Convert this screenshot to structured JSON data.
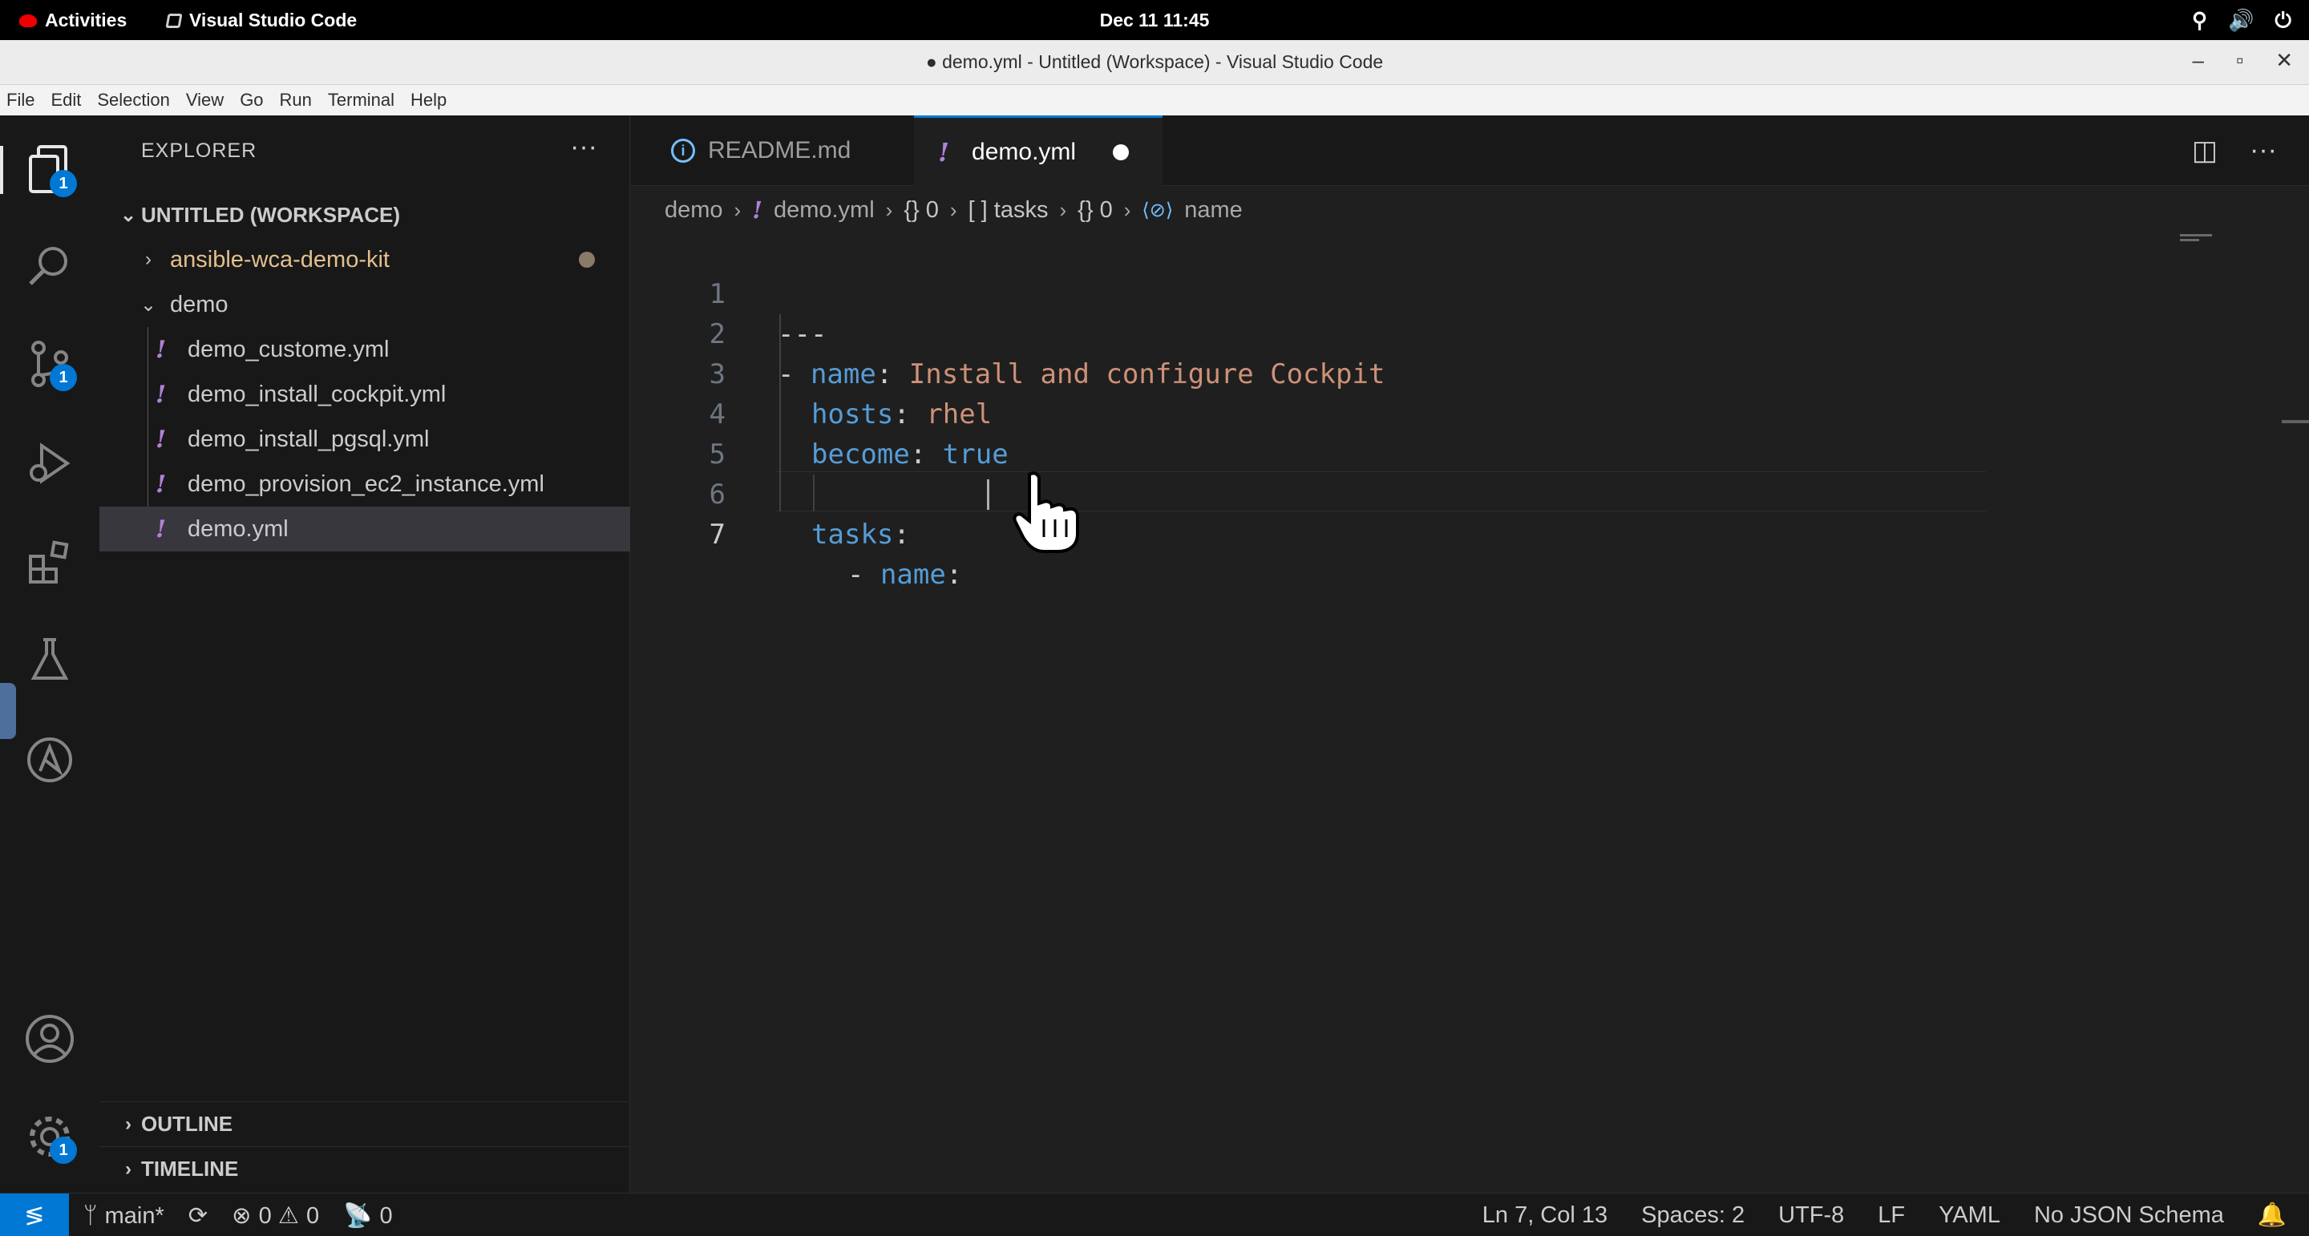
{
  "system": {
    "activities": "Activities",
    "app_name": "Visual Studio Code",
    "clock": "Dec 11  11:45"
  },
  "window": {
    "title": "● demo.yml - Untitled (Workspace) - Visual Studio Code"
  },
  "menu": [
    "File",
    "Edit",
    "Selection",
    "View",
    "Go",
    "Run",
    "Terminal",
    "Help"
  ],
  "activity_bar": {
    "explorer_badge": "1",
    "scm_badge": "1",
    "settings_badge": "1"
  },
  "sidebar": {
    "header": "EXPLORER",
    "workspace": "UNTITLED (WORKSPACE)",
    "items": [
      {
        "label": "ansible-wca-demo-kit"
      },
      {
        "label": "demo"
      },
      {
        "label": "demo_custome.yml"
      },
      {
        "label": "demo_install_cockpit.yml"
      },
      {
        "label": "demo_install_pgsql.yml"
      },
      {
        "label": "demo_provision_ec2_instance.yml"
      },
      {
        "label": "demo.yml"
      }
    ],
    "outline": "OUTLINE",
    "timeline": "TIMELINE"
  },
  "tabs": [
    {
      "label": "README.md"
    },
    {
      "label": "demo.yml"
    }
  ],
  "breadcrumb": {
    "folder": "demo",
    "file": "demo.yml",
    "seg1": "{} 0",
    "seg2": "[ ] tasks",
    "seg3": "{} 0",
    "seg4": "name"
  },
  "code_lines": [
    {
      "n": "1",
      "t1": "---"
    },
    {
      "n": "2",
      "t1": "- ",
      "t2": "name",
      "t3": ": ",
      "t4": "Install and configure Cockpit"
    },
    {
      "n": "3",
      "t2": "hosts",
      "t3": ": ",
      "t4": "rhel"
    },
    {
      "n": "4",
      "t2": "become",
      "t3": ": ",
      "t4": "true"
    },
    {
      "n": "5"
    },
    {
      "n": "6",
      "t2": "tasks",
      "t3": ":"
    },
    {
      "n": "7",
      "t1": "- ",
      "t2": "name",
      "t3": ": "
    }
  ],
  "status": {
    "branch": "main*",
    "errors": "0",
    "warnings": "0",
    "ports": "0",
    "position": "Ln 7, Col 13",
    "spaces": "Spaces: 2",
    "encoding": "UTF-8",
    "eol": "LF",
    "language": "YAML",
    "schema": "No JSON Schema"
  },
  "colors": {
    "accent": "#0078d4",
    "yaml_key": "#569cd6",
    "yaml_string": "#ce9178",
    "yaml_file_icon": "#b180d7"
  }
}
